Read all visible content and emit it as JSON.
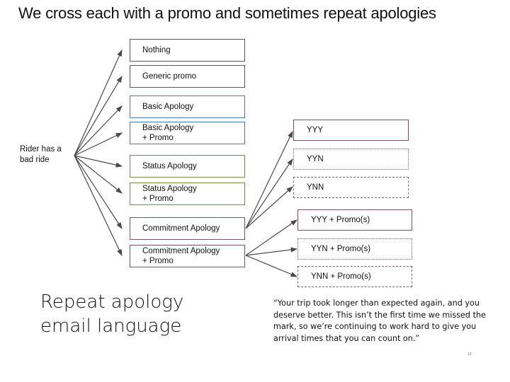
{
  "title": "We cross each with a promo and sometimes repeat apologies",
  "root_label": "Rider has a bad ride",
  "left_options": [
    {
      "line1": "Nothing",
      "line2": "",
      "group": "gray"
    },
    {
      "line1": "Generic promo",
      "line2": "",
      "group": "gray"
    },
    {
      "line1": "Basic Apology",
      "line2": "",
      "group": "blue"
    },
    {
      "line1": "Basic Apology",
      "line2": "+  Promo",
      "group": "blue"
    },
    {
      "line1": "Status Apology",
      "line2": "",
      "group": "green"
    },
    {
      "line1": "Status Apology",
      "line2": "+ Promo",
      "group": "green"
    },
    {
      "line1": "Commitment Apology",
      "line2": "",
      "group": "purple"
    },
    {
      "line1": "Commitment  Apology",
      "line2": "+ Promo",
      "group": "purple"
    }
  ],
  "right_options": [
    {
      "label": "YYY",
      "style": "solid"
    },
    {
      "label": "YYN",
      "style": "dotted"
    },
    {
      "label": "YNN",
      "style": "dash-dot"
    },
    {
      "label": "YYY + Promo(s)",
      "style": "solid"
    },
    {
      "label": "YYN + Promo(s)",
      "style": "dotted"
    },
    {
      "label": "YNN + Promo(s)",
      "style": "dash-dot"
    }
  ],
  "section_heading": {
    "line1": "Repeat apology",
    "line2": "email language"
  },
  "quote": "“Your trip took longer than expected again, and you deserve better. This isn’t the first time we missed the mark, so we’re continuing to work hard to give you arrival times that you can count on.”",
  "page_number": "10",
  "colors": {
    "gray": "#555555",
    "blue": "#4a76b0",
    "green": "#6a8f4a",
    "purple": "#7f4e6c",
    "arrow": "#4a4a4a"
  }
}
